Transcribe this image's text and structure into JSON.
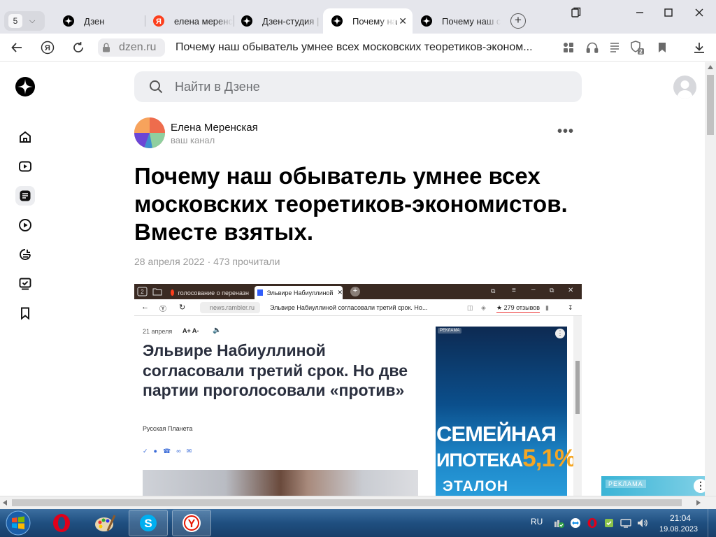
{
  "browser": {
    "tab_count": "5",
    "tabs": [
      {
        "title": "Дзен"
      },
      {
        "title": "елена меренс"
      },
      {
        "title": "Дзен-студия |"
      },
      {
        "title": "Почему на"
      },
      {
        "title": "Почему наш с"
      }
    ],
    "address": {
      "domain": "dzen.ru",
      "page_title": "Почему наш обыватель умнее всех московских теоретиков-эконом..."
    },
    "notifications_count": "2"
  },
  "dzen": {
    "search_placeholder": "Найти в Дзене",
    "author": {
      "name": "Елена Меренская",
      "subtitle": "ваш канал"
    },
    "article": {
      "title": "Почему наш обыватель умнее всех московских теоретиков-экономистов. Вместе взятых.",
      "meta": "28 апреля 2022 · 473 прочитали"
    },
    "ad_label": "РЕКЛАМА"
  },
  "embedded": {
    "tab1": "голосование о переназн",
    "tab2": "Эльвире Набиуллиной",
    "domain": "news.rambler.ru",
    "page_title": "Эльвире Набиуллиной согласовали третий срок. Но...",
    "reviews": "★ 279 отзывов",
    "date": "21 апреля",
    "font_controls": "A+  A-",
    "headline": "Эльвире Набиуллиной согласовали третий срок. Но две партии проголосовали «против»",
    "source": "Русская Планета",
    "ad_label": "РЕКЛАМА",
    "ad_line1": "СЕМЕЙНАЯ",
    "ad_line2": "ИПОТЕКА",
    "ad_rate": "5,1%",
    "ad_brand": "ЭТАЛОН"
  },
  "taskbar": {
    "lang": "RU",
    "time": "21:04",
    "date": "19.08.2023"
  }
}
